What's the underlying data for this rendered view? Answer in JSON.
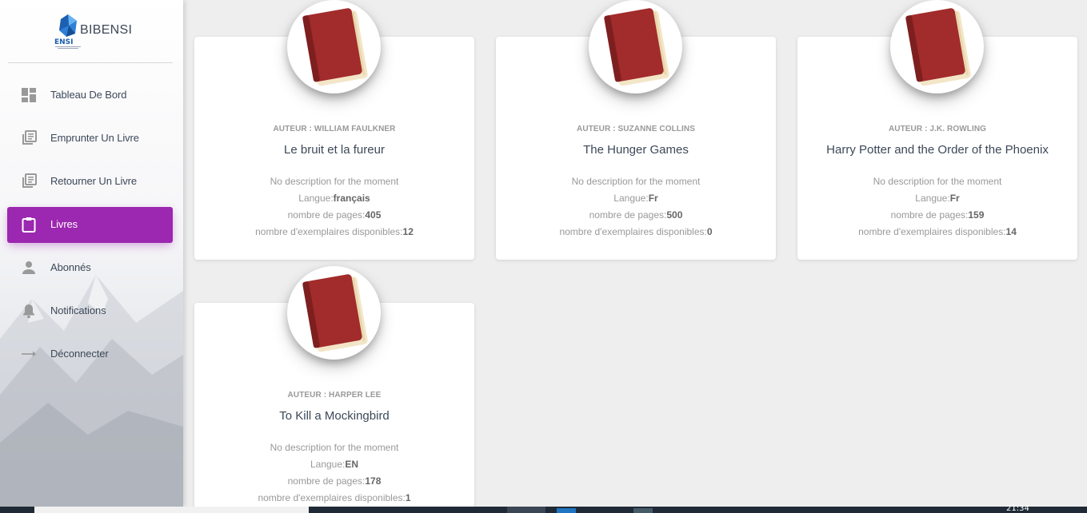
{
  "brand": {
    "name": "BIBENSI",
    "logo_text": "ENSI"
  },
  "sidebar": {
    "items": [
      {
        "label": "Tableau De Bord",
        "icon": "dashboard-icon",
        "active": false
      },
      {
        "label": "Emprunter Un Livre",
        "icon": "library-books-icon",
        "active": false
      },
      {
        "label": "Retourner Un Livre",
        "icon": "library-books-icon",
        "active": false
      },
      {
        "label": "Livres",
        "icon": "clipboard-icon",
        "active": true
      },
      {
        "label": "Abonnés",
        "icon": "person-icon",
        "active": false
      },
      {
        "label": "Notifications",
        "icon": "bell-icon",
        "active": false
      },
      {
        "label": "Déconnecter",
        "icon": "arrow-right-icon",
        "active": false
      }
    ]
  },
  "books": [
    {
      "author": "AUTEUR : WILLIAM FAULKNER",
      "title": "Le bruit et la fureur",
      "description": "No description for the moment",
      "language_label": "Langue:",
      "language": "français",
      "pages_label": "nombre de pages:",
      "pages": "405",
      "copies_label": "nombre d'exemplaires disponibles:",
      "copies": "12"
    },
    {
      "author": "AUTEUR : SUZANNE COLLINS",
      "title": "The Hunger Games",
      "description": "No description for the moment",
      "language_label": "Langue:",
      "language": "Fr",
      "pages_label": "nombre de pages:",
      "pages": "500",
      "copies_label": "nombre d'exemplaires disponibles:",
      "copies": "0"
    },
    {
      "author": "AUTEUR : J.K. ROWLING",
      "title": "Harry Potter and the Order of the Phoenix",
      "description": "No description for the moment",
      "language_label": "Langue:",
      "language": "Fr",
      "pages_label": "nombre de pages:",
      "pages": "159",
      "copies_label": "nombre d'exemplaires disponibles:",
      "copies": "14"
    },
    {
      "author": "AUTEUR : HARPER LEE",
      "title": "To Kill a Mockingbird",
      "description": "No description for the moment",
      "language_label": "Langue:",
      "language": "EN",
      "pages_label": "nombre de pages:",
      "pages": "178",
      "copies_label": "nombre d'exemplaires disponibles:",
      "copies": "1"
    }
  ],
  "taskbar": {
    "clock": "21:34"
  },
  "colors": {
    "accent": "#9c27b0",
    "book_cover": "#a22b2b",
    "page_bg": "#eeeeee"
  }
}
